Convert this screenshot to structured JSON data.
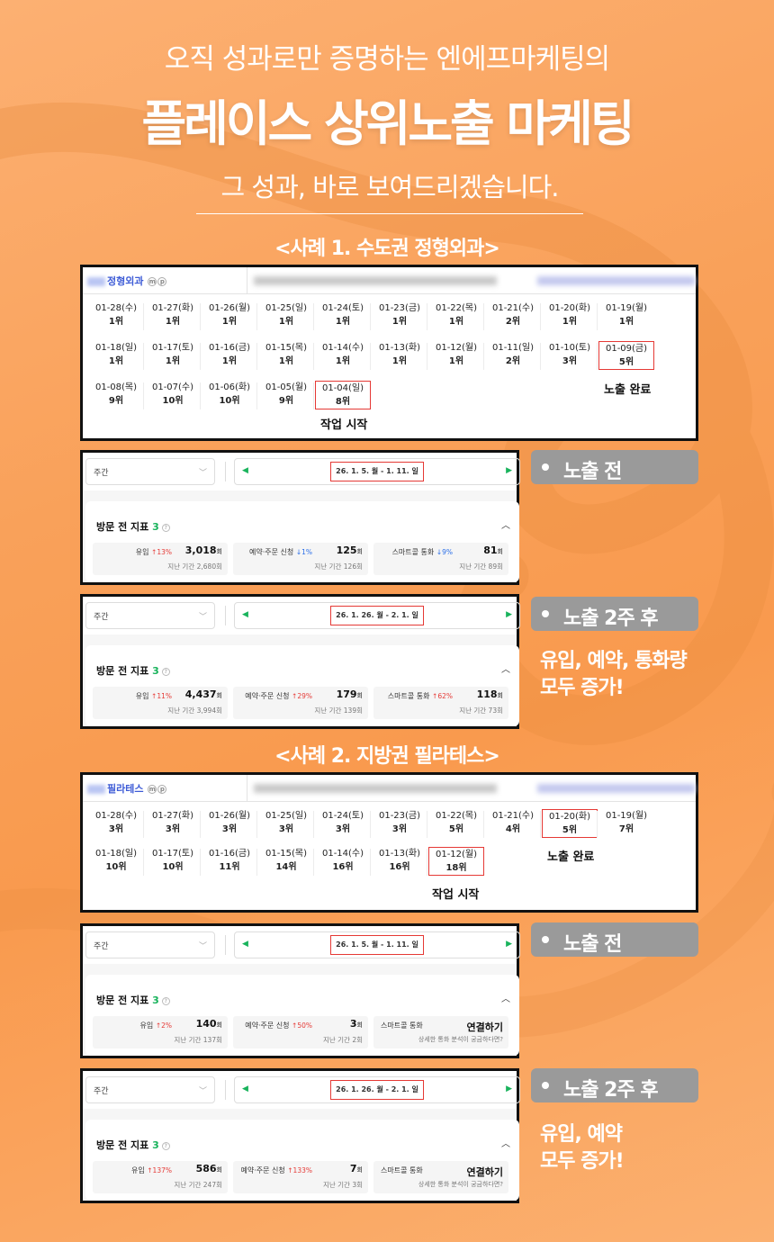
{
  "header": {
    "subtitle": "오직 성과로만 증명하는 엔에프마케팅의",
    "title": "플레이스 상위노출 마케팅",
    "tagline": "그 성과, 바로 보여드리겠습니다."
  },
  "case1": {
    "title": "<사례 1. 수도권 정형외과>",
    "place_name": "정형외과",
    "badge_m": "m",
    "badge_p": "p",
    "rankings": [
      {
        "date": "01-28(수)",
        "rank": "1위"
      },
      {
        "date": "01-27(화)",
        "rank": "1위"
      },
      {
        "date": "01-26(월)",
        "rank": "1위"
      },
      {
        "date": "01-25(일)",
        "rank": "1위"
      },
      {
        "date": "01-24(토)",
        "rank": "1위"
      },
      {
        "date": "01-23(금)",
        "rank": "1위"
      },
      {
        "date": "01-22(목)",
        "rank": "1위"
      },
      {
        "date": "01-21(수)",
        "rank": "2위"
      },
      {
        "date": "01-20(화)",
        "rank": "1위"
      },
      {
        "date": "01-19(월)",
        "rank": "1위"
      },
      {
        "date": "01-18(일)",
        "rank": "1위"
      },
      {
        "date": "01-17(토)",
        "rank": "1위"
      },
      {
        "date": "01-16(금)",
        "rank": "1위"
      },
      {
        "date": "01-15(목)",
        "rank": "1위"
      },
      {
        "date": "01-14(수)",
        "rank": "1위"
      },
      {
        "date": "01-13(화)",
        "rank": "1위"
      },
      {
        "date": "01-12(월)",
        "rank": "1위"
      },
      {
        "date": "01-11(일)",
        "rank": "2위"
      },
      {
        "date": "01-10(토)",
        "rank": "3위"
      },
      {
        "date": "01-09(금)",
        "rank": "5위"
      },
      {
        "date": "01-08(목)",
        "rank": "9위"
      },
      {
        "date": "01-07(수)",
        "rank": "10위"
      },
      {
        "date": "01-06(화)",
        "rank": "10위"
      },
      {
        "date": "01-05(월)",
        "rank": "9위"
      },
      {
        "date": "01-04(일)",
        "rank": "8위"
      }
    ],
    "label_done": "노출 완료",
    "label_start": "작업 시작",
    "before": {
      "period_select": "주간",
      "range": "26. 1. 5. 월  -  1. 11. 일",
      "section_title": "방문 전 지표",
      "section_count": "3",
      "m1": {
        "label": "유입",
        "change": "↑13%",
        "value": "3,018",
        "unit": "회",
        "prev": "지난 기간 2,680회"
      },
      "m2": {
        "label": "예약·주문 신청",
        "change": "↓1%",
        "value": "125",
        "unit": "회",
        "prev": "지난 기간 126회"
      },
      "m3": {
        "label": "스마트콜 통화",
        "change": "↓9%",
        "value": "81",
        "unit": "회",
        "prev": "지난 기간 89회"
      }
    },
    "after": {
      "period_select": "주간",
      "range": "26. 1. 26. 월  -  2. 1. 일",
      "section_title": "방문 전 지표",
      "section_count": "3",
      "m1": {
        "label": "유입",
        "change": "↑11%",
        "value": "4,437",
        "unit": "회",
        "prev": "지난 기간 3,994회"
      },
      "m2": {
        "label": "예약·주문 신청",
        "change": "↑29%",
        "value": "179",
        "unit": "회",
        "prev": "지난 기간 139회"
      },
      "m3": {
        "label": "스마트콜 통화",
        "change": "↑62%",
        "value": "118",
        "unit": "회",
        "prev": "지난 기간 73회"
      }
    },
    "pill_before": "노출 전",
    "pill_after": "노출 2주 후",
    "note_line1": "유입, 예약, 통화량",
    "note_line2": "모두 증가!"
  },
  "case2": {
    "title": "<사례 2. 지방권 필라테스>",
    "place_name": "필라테스",
    "badge_m": "m",
    "badge_p": "p",
    "rankings": [
      {
        "date": "01-28(수)",
        "rank": "3위"
      },
      {
        "date": "01-27(화)",
        "rank": "3위"
      },
      {
        "date": "01-26(월)",
        "rank": "3위"
      },
      {
        "date": "01-25(일)",
        "rank": "3위"
      },
      {
        "date": "01-24(토)",
        "rank": "3위"
      },
      {
        "date": "01-23(금)",
        "rank": "3위"
      },
      {
        "date": "01-22(목)",
        "rank": "5위"
      },
      {
        "date": "01-21(수)",
        "rank": "4위"
      },
      {
        "date": "01-20(화)",
        "rank": "5위"
      },
      {
        "date": "01-19(월)",
        "rank": "7위"
      },
      {
        "date": "01-18(일)",
        "rank": "10위"
      },
      {
        "date": "01-17(토)",
        "rank": "10위"
      },
      {
        "date": "01-16(금)",
        "rank": "11위"
      },
      {
        "date": "01-15(목)",
        "rank": "14위"
      },
      {
        "date": "01-14(수)",
        "rank": "16위"
      },
      {
        "date": "01-13(화)",
        "rank": "16위"
      },
      {
        "date": "01-12(월)",
        "rank": "18위"
      }
    ],
    "label_done": "노출 완료",
    "label_start": "작업 시작",
    "before": {
      "period_select": "주간",
      "range": "26. 1. 5. 월  -  1. 11. 일",
      "section_title": "방문 전 지표",
      "section_count": "3",
      "m1": {
        "label": "유입",
        "change": "↑2%",
        "value": "140",
        "unit": "회",
        "prev": "지난 기간 137회"
      },
      "m2": {
        "label": "예약·주문 신청",
        "change": "↑50%",
        "value": "3",
        "unit": "회",
        "prev": "지난 기간 2회"
      },
      "m3": {
        "label": "스마트콜 통화",
        "connect": "연결하기",
        "prev": "상세한 통화 분석이 궁금하다면?"
      }
    },
    "after": {
      "period_select": "주간",
      "range": "26. 1. 26. 월  -  2. 1. 일",
      "section_title": "방문 전 지표",
      "section_count": "3",
      "m1": {
        "label": "유입",
        "change": "↑137%",
        "value": "586",
        "unit": "회",
        "prev": "지난 기간 247회"
      },
      "m2": {
        "label": "예약·주문 신청",
        "change": "↑133%",
        "value": "7",
        "unit": "회",
        "prev": "지난 기간 3회"
      },
      "m3": {
        "label": "스마트콜 통화",
        "connect": "연결하기",
        "prev": "상세한 통화 분석이 궁금하다면?"
      }
    },
    "pill_before": "노출 전",
    "pill_after": "노출 2주 후",
    "note_line1": "유입, 예약",
    "note_line2": "모두 증가!"
  }
}
